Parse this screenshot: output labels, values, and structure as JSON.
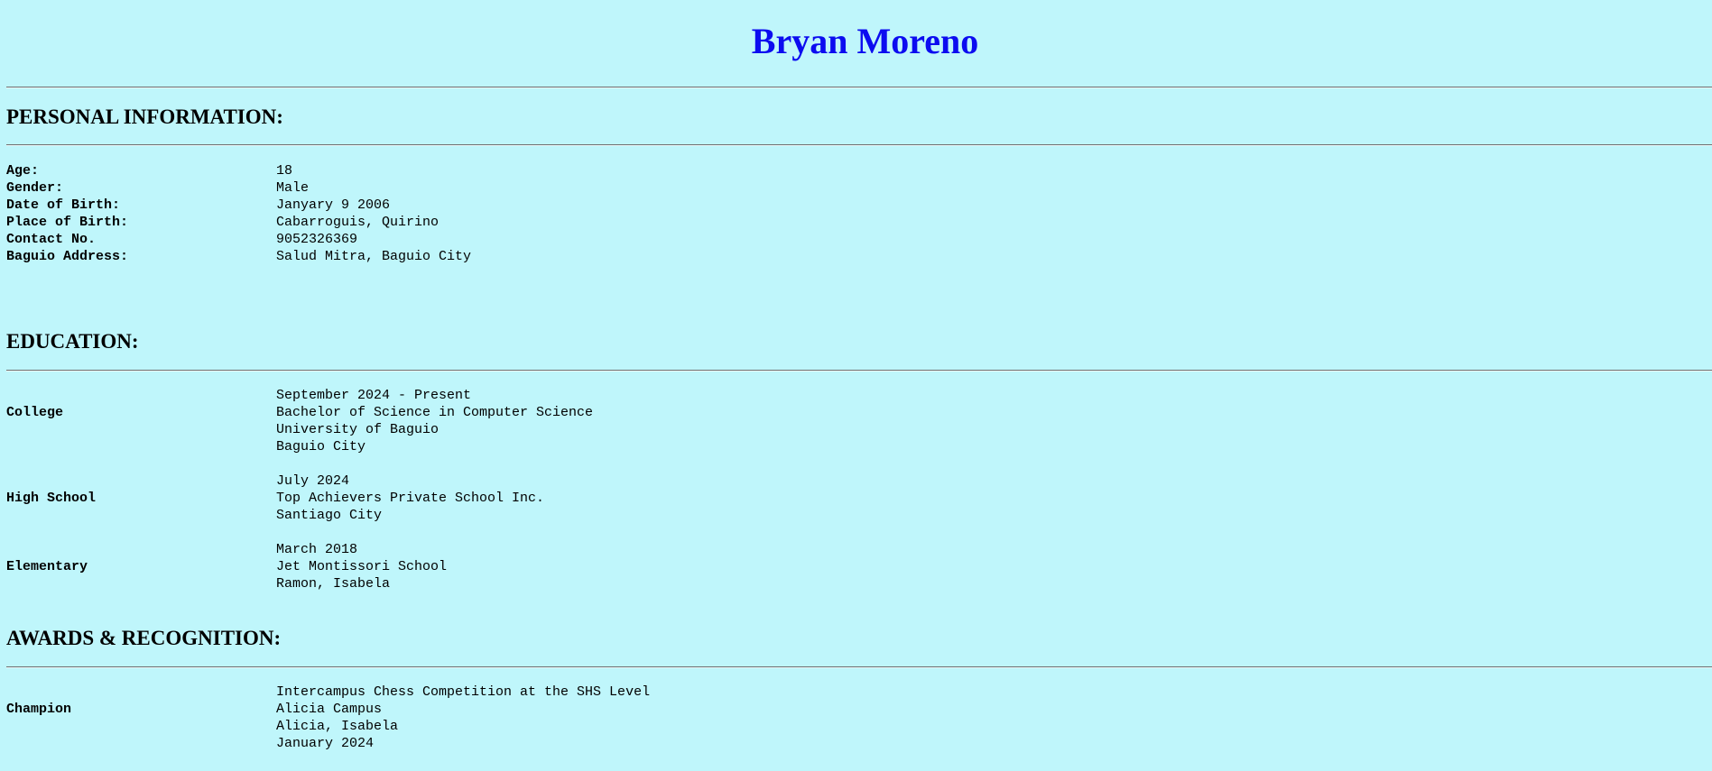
{
  "name": "Bryan Moreno",
  "personal": {
    "heading": "PERSONAL INFORMATION:",
    "age_label": "Age:",
    "age": "18",
    "gender_label": "Gender:",
    "gender": "Male",
    "dob_label": "Date of Birth:",
    "dob": "Janyary 9 2006",
    "pob_label": "Place of Birth:",
    "pob": "Cabarroguis, Quirino",
    "contact_label": "Contact No.",
    "contact": "9052326369",
    "address_label": "Baguio Address:",
    "address": "Salud Mitra, Baguio City"
  },
  "education": {
    "heading": "EDUCATION:",
    "college": {
      "label": "College",
      "date": "September 2024 - Present",
      "program": "Bachelor of Science in Computer Science",
      "school": "University of Baguio",
      "location": "Baguio City"
    },
    "high_school": {
      "label": "High School",
      "date": "July 2024",
      "school": "Top Achievers Private School Inc.",
      "location": "Santiago City"
    },
    "elementary": {
      "label": "Elementary",
      "date": "March 2018",
      "school": "Jet Montissori School",
      "location": "Ramon, Isabela"
    }
  },
  "awards": {
    "heading": "AWARDS & RECOGNITION:",
    "champion": {
      "label": "Champion",
      "event": "Intercampus Chess Competition at the SHS Level",
      "campus": "Alicia Campus",
      "location": "Alicia, Isabela",
      "date": "January 2024"
    }
  }
}
